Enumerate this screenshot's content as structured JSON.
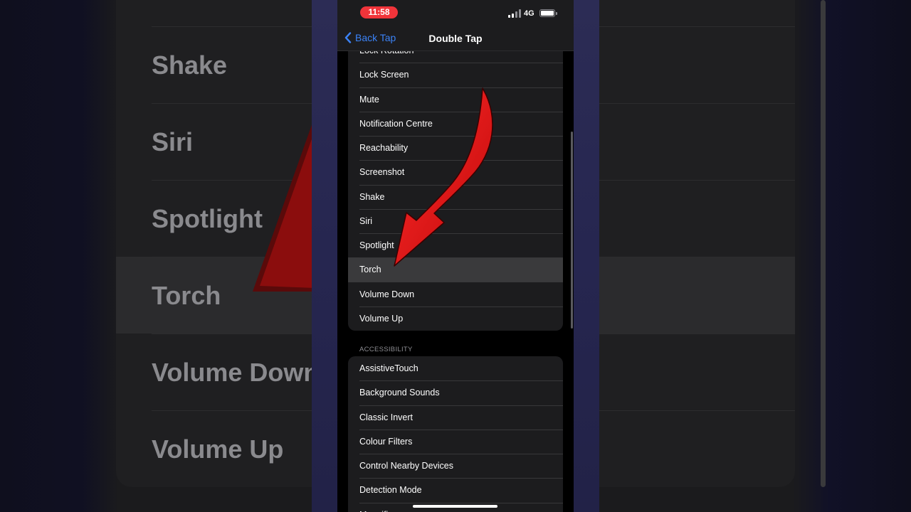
{
  "status_bar": {
    "time": "11:58",
    "network": "4G"
  },
  "nav": {
    "back_label": "Back Tap",
    "title": "Double Tap"
  },
  "system_items": [
    {
      "label": "Lock Rotation"
    },
    {
      "label": "Lock Screen"
    },
    {
      "label": "Mute"
    },
    {
      "label": "Notification Centre"
    },
    {
      "label": "Reachability"
    },
    {
      "label": "Screenshot"
    },
    {
      "label": "Shake"
    },
    {
      "label": "Siri"
    },
    {
      "label": "Spotlight"
    },
    {
      "label": "Torch",
      "selected": true
    },
    {
      "label": "Volume Down"
    },
    {
      "label": "Volume Up"
    }
  ],
  "accessibility_header": "ACCESSIBILITY",
  "accessibility_items": [
    {
      "label": "AssistiveTouch"
    },
    {
      "label": "Background Sounds"
    },
    {
      "label": "Classic Invert"
    },
    {
      "label": "Colour Filters"
    },
    {
      "label": "Control Nearby Devices"
    },
    {
      "label": "Detection Mode"
    },
    {
      "label": "Magnifier"
    }
  ],
  "background_items": [
    {
      "label": "Shake"
    },
    {
      "label": "Siri"
    },
    {
      "label": "Spotlight"
    },
    {
      "label": "Torch",
      "selected": true
    },
    {
      "label": "Volume Down"
    },
    {
      "label": "Volume Up"
    }
  ],
  "colors": {
    "accent": "#3b82f6",
    "arrow": "#e01010",
    "time_pill": "#f0343a"
  },
  "icons": [
    "chevron-left-icon",
    "signal-icon",
    "battery-icon",
    "red-arrow-icon"
  ]
}
